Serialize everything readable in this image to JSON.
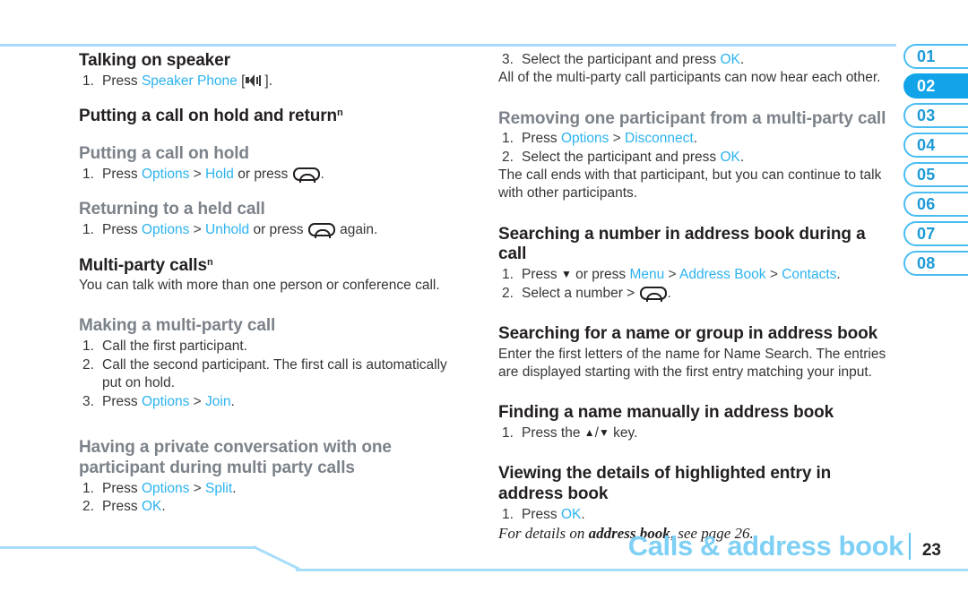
{
  "page": {
    "footer_title": "Calls & address book",
    "page_number": "23"
  },
  "rail": {
    "tabs": [
      {
        "label": "01",
        "active": false
      },
      {
        "label": "02",
        "active": true
      },
      {
        "label": "03",
        "active": false
      },
      {
        "label": "04",
        "active": false
      },
      {
        "label": "05",
        "active": false
      },
      {
        "label": "06",
        "active": false
      },
      {
        "label": "07",
        "active": false
      },
      {
        "label": "08",
        "active": false
      }
    ]
  },
  "colors": {
    "accent_blue": "#2cb3ef",
    "rail_blue": "#49bdf2",
    "rail_active": "#11a4e8",
    "rule_blue": "#a8ddf9",
    "footer_title": "#7fd0f5",
    "heading_gray": "#7b8289",
    "heading_black": "#231f20",
    "body_text": "#363636"
  },
  "left_column": {
    "s1": {
      "heading": "Talking on speaker",
      "step1_num": "1.",
      "step1_a": "Press ",
      "step1_link": "Speaker Phone",
      "step1_b": " [",
      "step1_c": "].",
      "icon": "speaker-phone-icon"
    },
    "s2": {
      "heading": "Putting a call on hold and return",
      "heading_sup": "n"
    },
    "s3": {
      "heading": "Putting a call on hold",
      "step1_num": "1.",
      "step1_a": "Press ",
      "step1_link1": "Options",
      "step1_gt": " > ",
      "step1_link2": "Hold",
      "step1_b": " or press ",
      "step1_c": ".",
      "icon": "end-call-key-icon"
    },
    "s4": {
      "heading": "Returning to a held call",
      "step1_num": "1.",
      "step1_a": "Press ",
      "step1_link1": "Options",
      "step1_gt": " > ",
      "step1_link2": "Unhold",
      "step1_b": " or press ",
      "step1_c": " again.",
      "icon": "end-call-key-icon"
    },
    "s5": {
      "heading": "Multi-party calls",
      "heading_sup": "n",
      "body": "You can talk with more than one person or conference call."
    },
    "s6": {
      "heading": "Making a multi-party call",
      "step1_num": "1.",
      "step1_text": "Call the first participant.",
      "step2_num": "2.",
      "step2_text": "Call the second participant. The first call is automatically put on hold.",
      "step3_num": "3.",
      "step3_a": "Press ",
      "step3_link1": "Options",
      "step3_gt": " > ",
      "step3_link2": "Join",
      "step3_b": "."
    },
    "s7": {
      "heading": "Having a private conversation with one participant during multi party calls",
      "step1_num": "1.",
      "step1_a": "Press ",
      "step1_link1": "Options",
      "step1_gt": " > ",
      "step1_link2": "Split",
      "step1_b": ".",
      "step2_num": "2.",
      "step2_a": "Press ",
      "step2_link1": "OK",
      "step2_b": "."
    }
  },
  "right_column": {
    "s1": {
      "step3_num": "3.",
      "step3_a": "Select the participant and press ",
      "step3_link": "OK",
      "step3_b": ".",
      "body": "All of the multi-party call participants can now hear each other."
    },
    "s2": {
      "heading": "Removing one participant from a multi-party call",
      "step1_num": "1.",
      "step1_a": "Press ",
      "step1_link1": "Options",
      "step1_gt": " > ",
      "step1_link2": "Disconnect",
      "step1_b": ".",
      "step2_num": "2.",
      "step2_a": "Select the participant and press ",
      "step2_link1": "OK",
      "step2_b": ".",
      "body": "The call ends with that participant, but you can continue to talk with other participants."
    },
    "s3": {
      "heading": "Searching a number in address book during a call",
      "step1_num": "1.",
      "step1_a": "Press ",
      "step1_arrow": "▼",
      "step1_b": " or press ",
      "step1_link1": "Menu",
      "step1_gt1": " > ",
      "step1_link2": "Address Book",
      "step1_gt2": " > ",
      "step1_link3": "Contacts",
      "step1_c": ".",
      "step2_num": "2.",
      "step2_a": "Select a number > ",
      "step2_b": ".",
      "icon": "end-call-key-icon"
    },
    "s4": {
      "heading": "Searching for a name or group in address book",
      "body": "Enter the first letters of the name for Name Search. The entries are displayed starting with the first entry matching your input."
    },
    "s5": {
      "heading": "Finding a name manually in address book",
      "step1_num": "1.",
      "step1_a": "Press the ",
      "step1_arrow_up": "▲",
      "step1_slash": "/",
      "step1_arrow_dn": "▼",
      "step1_b": " key."
    },
    "s6": {
      "heading": "Viewing the details of highlighted entry in address book",
      "step1_num": "1.",
      "step1_a": "Press ",
      "step1_link1": "OK",
      "step1_b": ".",
      "note_a": "For details on ",
      "note_b": "address book",
      "note_c": ", see page 26."
    }
  }
}
